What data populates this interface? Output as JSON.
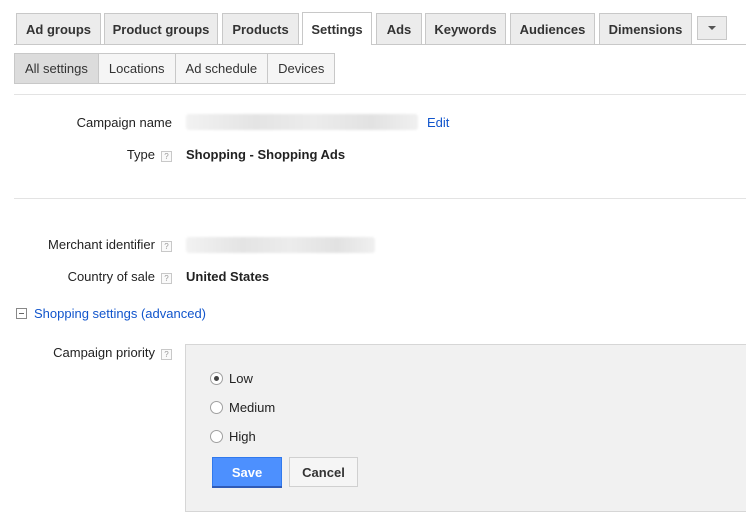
{
  "tabs": [
    {
      "label": "Ad groups",
      "active": false
    },
    {
      "label": "Product groups",
      "active": false
    },
    {
      "label": "Products",
      "active": false
    },
    {
      "label": "Settings",
      "active": true
    },
    {
      "label": "Ads",
      "active": false
    },
    {
      "label": "Keywords",
      "active": false
    },
    {
      "label": "Audiences",
      "active": false
    },
    {
      "label": "Dimensions",
      "active": false
    }
  ],
  "sub_tabs": [
    {
      "label": "All settings",
      "active": true
    },
    {
      "label": "Locations",
      "active": false
    },
    {
      "label": "Ad schedule",
      "active": false
    },
    {
      "label": "Devices",
      "active": false
    }
  ],
  "settings": {
    "campaign_name_label": "Campaign name",
    "edit_link": "Edit",
    "type_label": "Type",
    "type_value": "Shopping - Shopping Ads",
    "merchant_label": "Merchant identifier",
    "country_label": "Country of sale",
    "country_value": "United States",
    "help_glyph": "?"
  },
  "shopping": {
    "section_title": "Shopping settings (advanced)",
    "priority_label": "Campaign priority",
    "options": [
      {
        "label": "Low",
        "checked": true
      },
      {
        "label": "Medium",
        "checked": false
      },
      {
        "label": "High",
        "checked": false
      }
    ],
    "save_label": "Save",
    "cancel_label": "Cancel"
  }
}
